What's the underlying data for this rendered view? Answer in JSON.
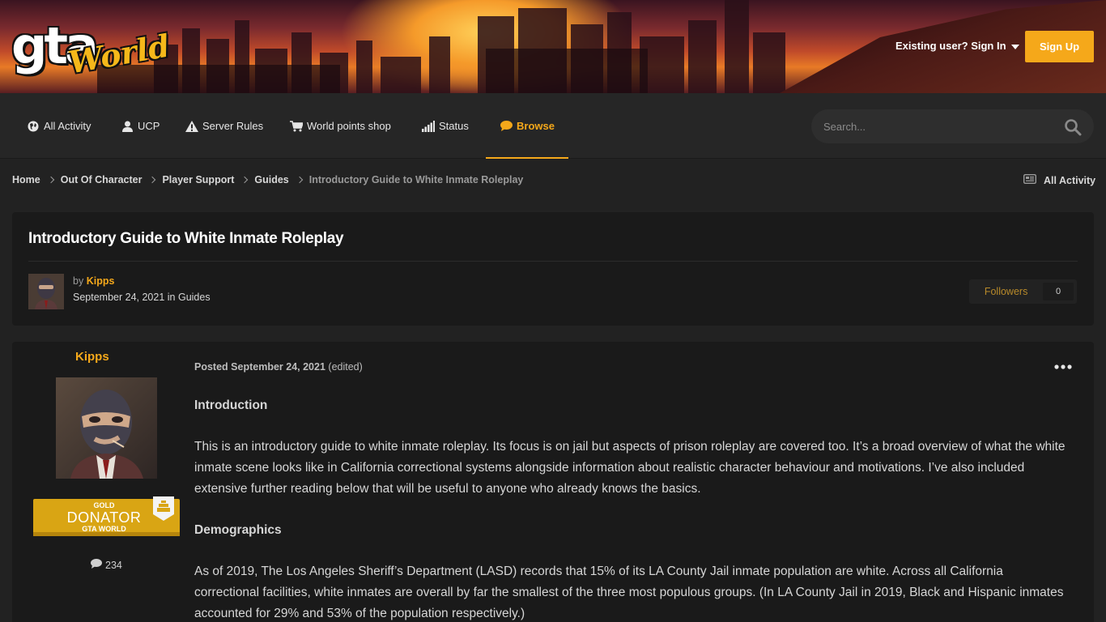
{
  "header": {
    "logo_top": "gta",
    "logo_bottom": "World",
    "signin_label": "Existing user? Sign In",
    "signup_label": "Sign Up"
  },
  "nav": {
    "items": [
      {
        "label": "All Activity",
        "icon": "globe-icon"
      },
      {
        "label": "UCP",
        "icon": "user-icon"
      },
      {
        "label": "Server Rules",
        "icon": "warning-icon"
      },
      {
        "label": "World points shop",
        "icon": "cart-icon"
      },
      {
        "label": "Status",
        "icon": "signal-icon"
      },
      {
        "label": "Browse",
        "icon": "comment-icon",
        "active": true
      }
    ],
    "search_placeholder": "Search..."
  },
  "breadcrumb": {
    "items": [
      "Home",
      "Out Of Character",
      "Player Support",
      "Guides"
    ],
    "current": "Introductory Guide to White Inmate Roleplay",
    "right_link": "All Activity"
  },
  "topic": {
    "title": "Introductory Guide to White Inmate Roleplay",
    "by_prefix": "by",
    "author": "Kipps",
    "date": "September 24, 2021",
    "in_word": "in",
    "category": "Guides",
    "followers_label": "Followers",
    "followers_count": "0"
  },
  "post": {
    "author": "Kipps",
    "badge": {
      "line1": "GOLD",
      "line2": "DONATOR",
      "line3": "GTA WORLD"
    },
    "post_count": "234",
    "meta_prefix": "Posted",
    "date": "September 24, 2021",
    "edited": "(edited)",
    "heading1": "Introduction",
    "para1": "This is an introductory guide to white inmate roleplay. Its focus is on jail but aspects of prison roleplay are covered too. It’s a broad overview of what the white inmate scene looks like in California correctional systems alongside information about realistic character behaviour and motivations. I’ve also included extensive  further reading below that will be useful to anyone who already knows the basics.",
    "heading2": "Demographics",
    "para2": "As of 2019, The Los Angeles Sheriff’s Department (LASD) records that 15% of its LA County Jail inmate population are white. Across all California correctional facilities, white inmates are overall by far the smallest of the three most populous groups. (In LA County Jail in 2019, Black and Hispanic inmates accounted for 29% and 53% of the population respectively.)"
  },
  "colors": {
    "accent": "#f5a81a",
    "background": "#222222",
    "panel": "#1a1a1a"
  }
}
